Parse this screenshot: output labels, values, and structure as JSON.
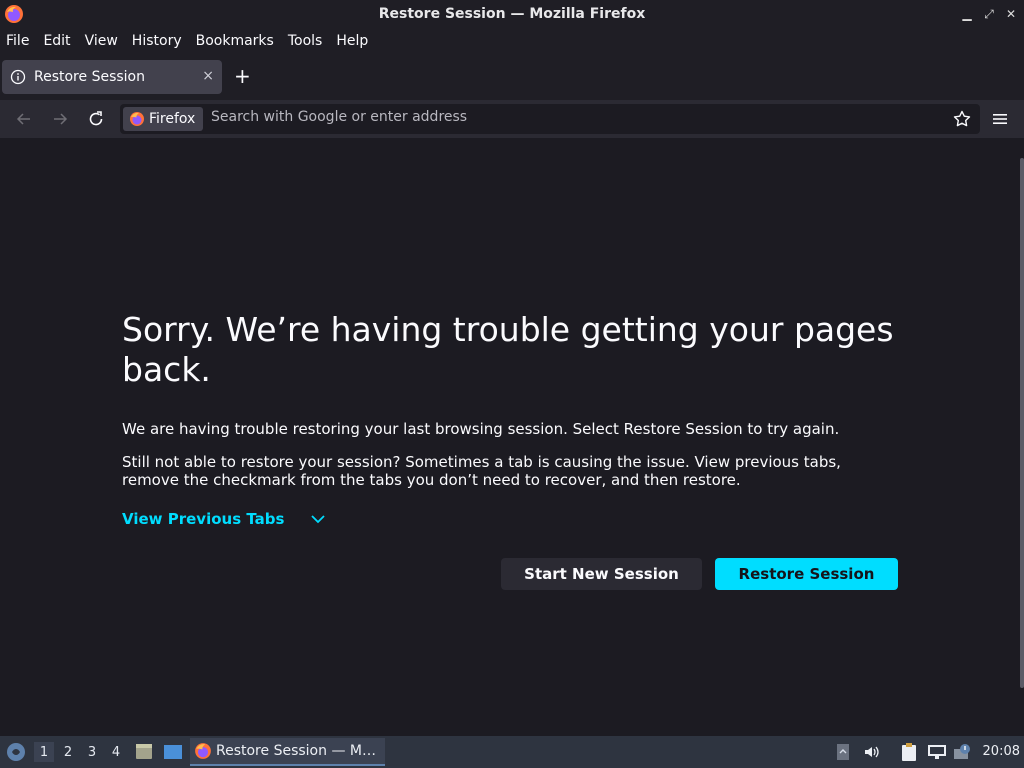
{
  "window": {
    "title": "Restore Session — Mozilla Firefox"
  },
  "menubar": {
    "items": [
      "File",
      "Edit",
      "View",
      "History",
      "Bookmarks",
      "Tools",
      "Help"
    ]
  },
  "tabs": {
    "active_label": "Restore Session",
    "close_glyph": "×",
    "new_tab_glyph": "+"
  },
  "navbar": {
    "identity_label": "Firefox",
    "url_placeholder": "Search with Google or enter address"
  },
  "page": {
    "heading": "Sorry. We’re having trouble getting your pages back.",
    "paragraph1": "We are having trouble restoring your last browsing session. Select Restore Session to try again.",
    "paragraph2": "Still not able to restore your session? Sometimes a tab is causing the issue. View previous tabs, remove the checkmark from the tabs you don’t need to recover, and then restore.",
    "view_previous_tabs": "View Previous Tabs",
    "start_new_session": "Start New Session",
    "restore_session": "Restore Session",
    "accent_color": "#00ddff"
  },
  "taskbar": {
    "workspaces": [
      "1",
      "2",
      "3",
      "4"
    ],
    "active_workspace": "1",
    "task_label": "Restore Session — M…",
    "clock": "20:08"
  }
}
